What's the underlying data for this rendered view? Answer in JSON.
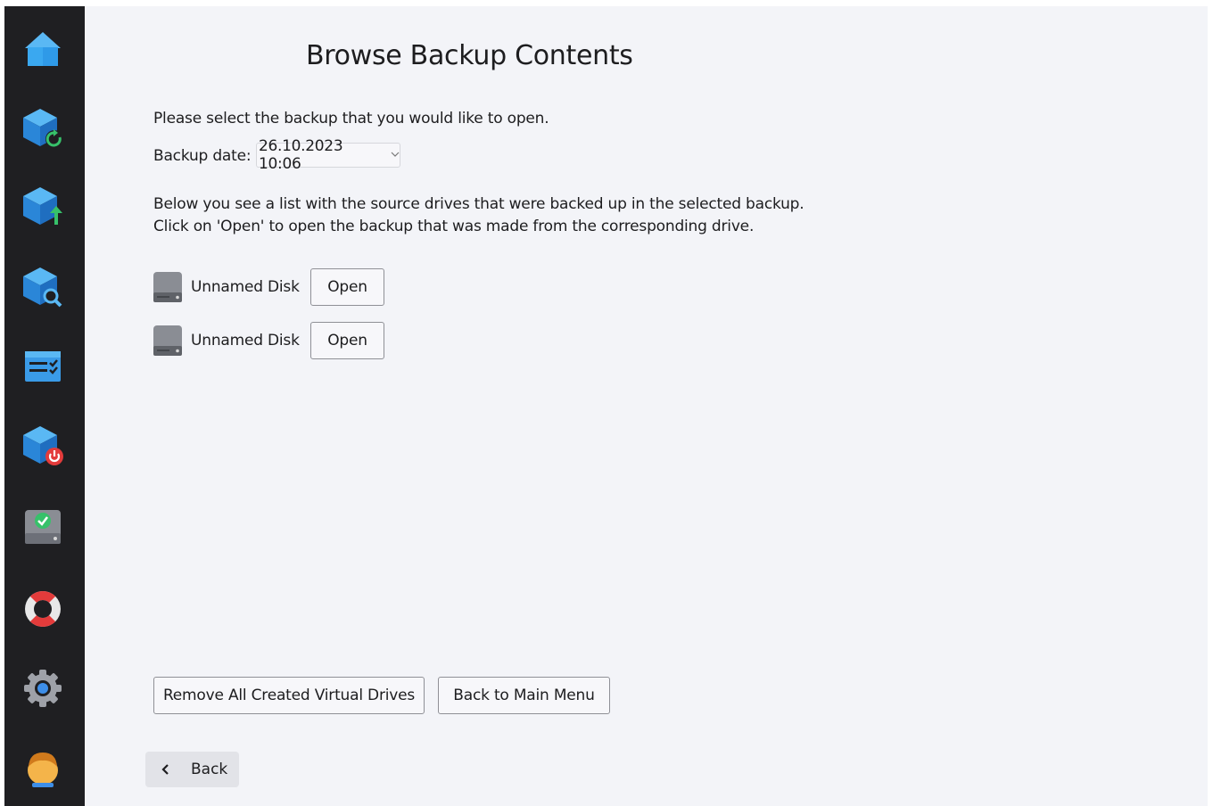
{
  "sidebar": {
    "items": [
      {
        "icon": "home-icon"
      },
      {
        "icon": "restore-backup-icon"
      },
      {
        "icon": "create-backup-icon"
      },
      {
        "icon": "browse-backup-icon"
      },
      {
        "icon": "tasks-checklist-icon"
      },
      {
        "icon": "shutdown-backup-icon"
      },
      {
        "icon": "disk-check-icon"
      },
      {
        "icon": "lifebuoy-help-icon"
      },
      {
        "icon": "settings-gear-icon"
      },
      {
        "icon": "user-avatar-icon"
      }
    ]
  },
  "main": {
    "title": "Browse Backup Contents",
    "instruction": "Please select the backup that you would like to open.",
    "backup_date_label": "Backup date:",
    "backup_date_value": "26.10.2023 10:06",
    "description_line1": "Below you see a list with the source drives that were backed up in the selected backup.",
    "description_line2": "Click on 'Open' to open the backup that was made from the corresponding drive.",
    "drives": [
      {
        "label": "Unnamed Disk",
        "button": "Open"
      },
      {
        "label": "Unnamed Disk",
        "button": "Open"
      }
    ],
    "remove_button": "Remove All Created Virtual Drives",
    "main_menu_button": "Back to Main Menu",
    "back_button": "Back"
  },
  "colors": {
    "sidebar_bg": "#1f1f22",
    "content_bg": "#f3f4f8",
    "accent_blue": "#3d8ee8"
  }
}
